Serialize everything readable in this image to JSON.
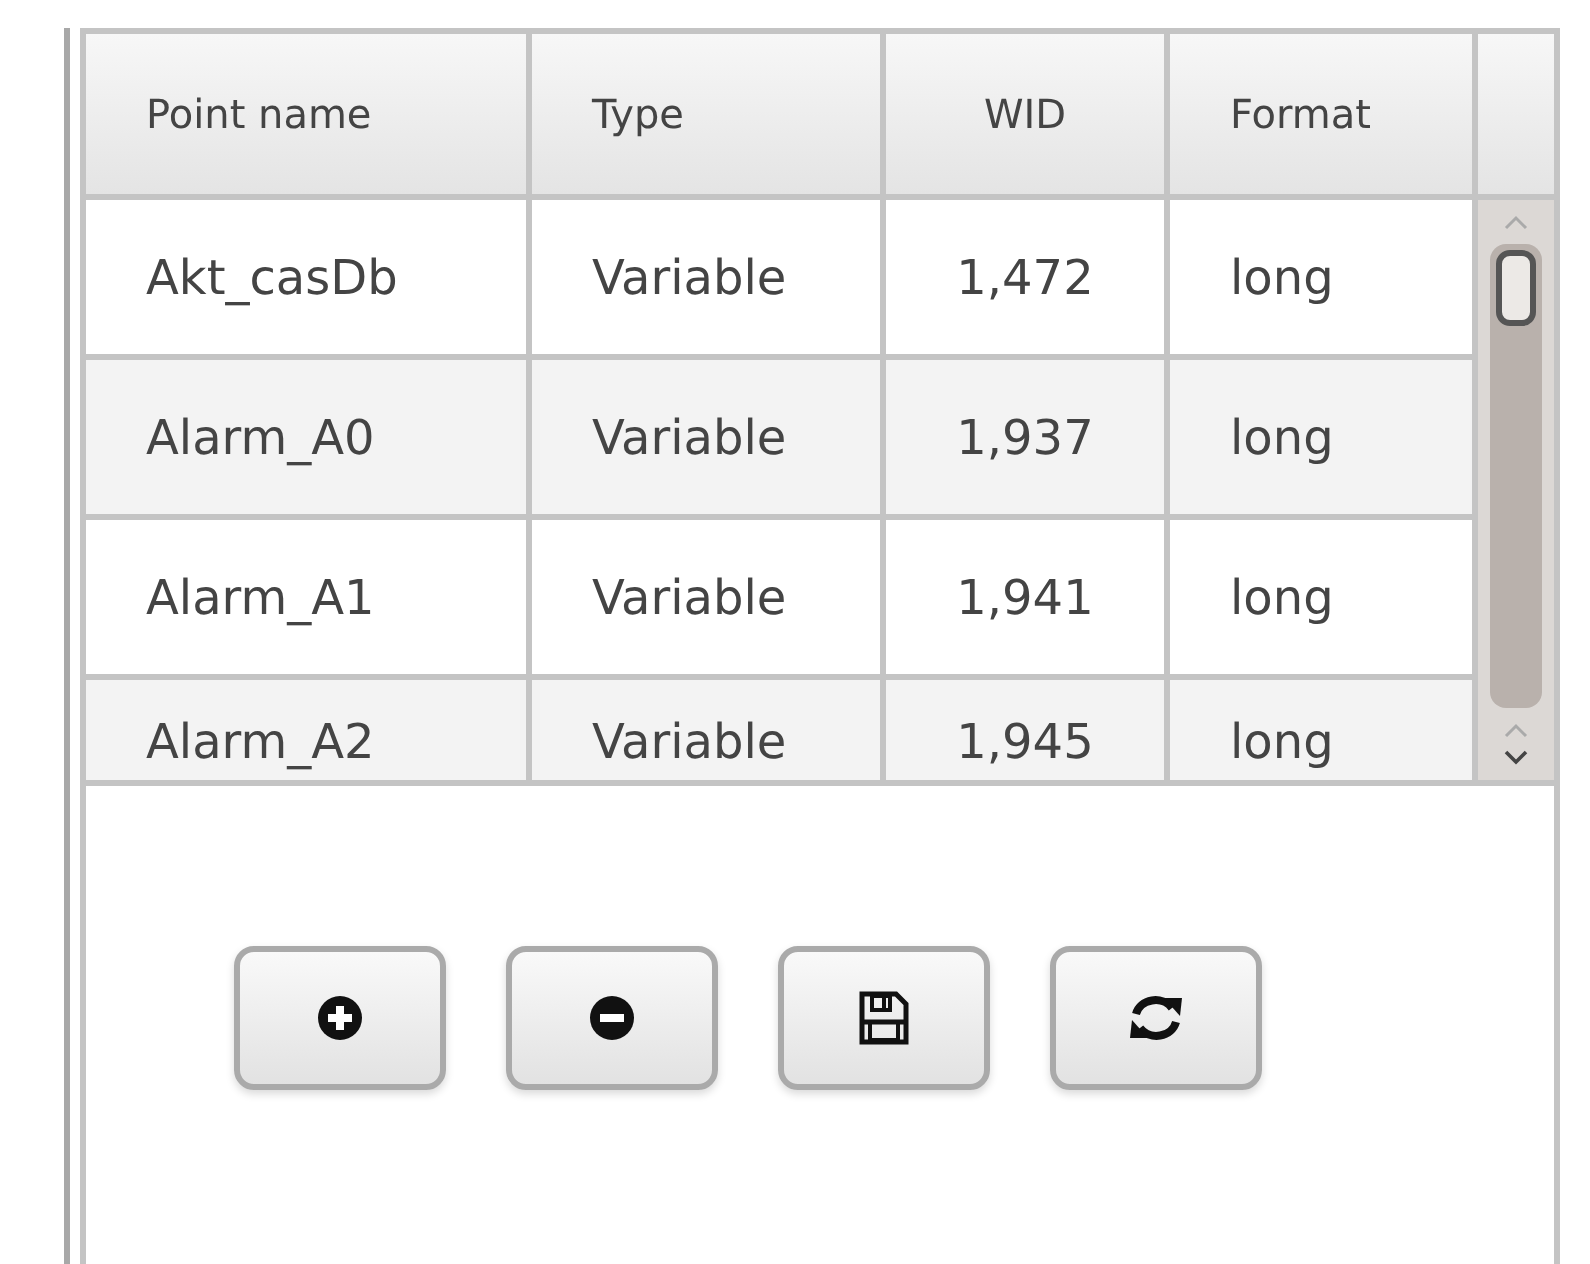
{
  "table": {
    "columns": [
      "Point name",
      "Type",
      "WID",
      "Format"
    ],
    "rows": [
      {
        "cells": [
          "Akt_casDb",
          "Variable",
          "1,472",
          "long"
        ]
      },
      {
        "cells": [
          "Alarm_A0",
          "Variable",
          "1,937",
          "long"
        ]
      },
      {
        "cells": [
          "Alarm_A1",
          "Variable",
          "1,941",
          "long"
        ]
      },
      {
        "cells": [
          "Alarm_A2",
          "Variable",
          "1,945",
          "long"
        ]
      }
    ]
  },
  "buttons": [
    {
      "kind": "add"
    },
    {
      "kind": "remove"
    },
    {
      "kind": "save"
    },
    {
      "kind": "refresh"
    }
  ]
}
